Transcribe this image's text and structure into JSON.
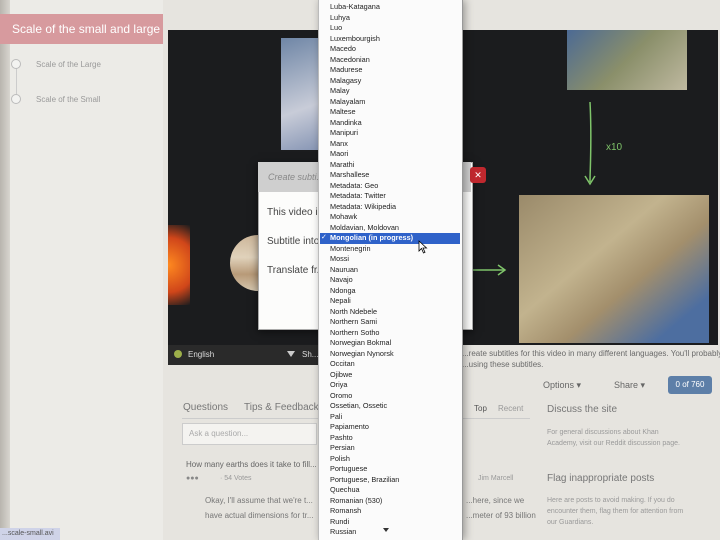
{
  "sidebar": {
    "header": "Scale of the small and large",
    "steps": [
      "Scale of the Large",
      "Scale of the Small"
    ],
    "url_snippet": "...scale-small.avi"
  },
  "top_caption": "...",
  "video": {
    "language": "English",
    "share": "Sh..."
  },
  "dialog": {
    "title": "Create subti...",
    "line1": "This video i...",
    "line2": "Subtitle into",
    "line3": "Translate fr..."
  },
  "description": [
    "...reate subtitles for this video in many different languages. You'll probably",
    "...using these subtitles."
  ],
  "toolbar": {
    "options": "Options ▾",
    "share": "Share ▾",
    "counter": "0 of 760"
  },
  "discussion": {
    "tabs": [
      "Questions",
      "Tips & Feedback",
      "Top",
      "Recent"
    ],
    "ask_placeholder": "Ask a question...",
    "question": "How many earths does it take to fill...",
    "votes": "· 54 Votes",
    "author": "Jim Marcell",
    "answer_line1": "Okay, I'll assume that we're t...",
    "answer_line1b": "...here, since we",
    "answer_line2": "have actual dimensions for tr...",
    "answer_line2b": "...meter of 93 billion"
  },
  "right": {
    "h1": "Discuss the site",
    "p1": [
      "For general discussions about Khan",
      "Academy, visit our Reddit discussion page."
    ],
    "h2": "Flag inappropriate posts",
    "p2": [
      "Here are posts to avoid making. If you do",
      "encounter them, flag them for attention from",
      "our Guardians."
    ]
  },
  "menu": {
    "items": [
      "Luba-Katagana",
      "Luhya",
      "Luo",
      "Luxembourgish",
      "Macedo",
      "Macedonian",
      "Madurese",
      "Malagasy",
      "Malay",
      "Malayalam",
      "Maltese",
      "Mandinka",
      "Manipuri",
      "Manx",
      "Maori",
      "Marathi",
      "Marshallese",
      "Metadata: Geo",
      "Metadata: Twitter",
      "Metadata: Wikipedia",
      "Mohawk",
      "Moldavian, Moldovan",
      "Mongolian (in progress)",
      "Montenegrin",
      "Mossi",
      "Nauruan",
      "Navajo",
      "Ndonga",
      "Nepali",
      "North Ndebele",
      "Northern Sami",
      "Northern Sotho",
      "Norwegian Bokmal",
      "Norwegian Nynorsk",
      "Occitan",
      "Ojibwe",
      "Oriya",
      "Oromo",
      "Ossetian, Ossetic",
      "Pali",
      "Papiamento",
      "Pashto",
      "Persian",
      "Polish",
      "Portuguese",
      "Portuguese, Brazilian",
      "Quechua",
      "Romanian (530)",
      "Romansh",
      "Rundi",
      "Russian"
    ],
    "selected_index": 22,
    "check": "✓"
  },
  "colors": {
    "accent": "#2f62c9",
    "sidebar_header": "#d79a9e",
    "close": "#c0282e",
    "counter": "#5d7fa8"
  }
}
